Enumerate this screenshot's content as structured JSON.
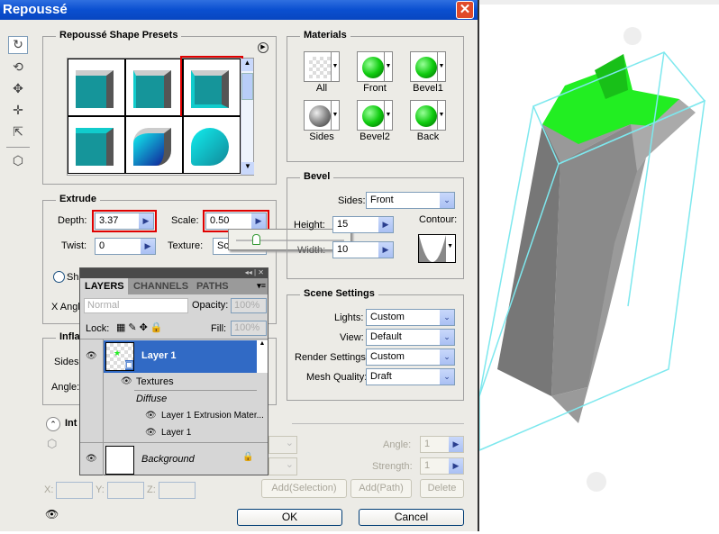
{
  "title": "Repoussé",
  "presets": {
    "title": "Repoussé Shape Presets",
    "count": 6,
    "selected_index": 2
  },
  "materials": {
    "title": "Materials",
    "items": [
      "All",
      "Front",
      "Bevel1",
      "Sides",
      "Bevel2",
      "Back"
    ]
  },
  "extrude": {
    "title": "Extrude",
    "depth_label": "Depth:",
    "depth": "3.37",
    "scale_label": "Scale:",
    "scale": "0.50",
    "twist_label": "Twist:",
    "twist": "0",
    "texture_label": "Texture:",
    "texture": "Scale",
    "shear_label": "She",
    "xangle_label": "X Angl"
  },
  "bevel": {
    "title": "Bevel",
    "sides_label": "Sides:",
    "sides": "Front",
    "height_label": "Height:",
    "height": "15",
    "width_label": "Width:",
    "width": "10",
    "contour_label": "Contour:"
  },
  "scene": {
    "title": "Scene Settings",
    "lights_label": "Lights:",
    "lights": "Custom",
    "view_label": "View:",
    "view": "Default",
    "render_label": "Render Settings:",
    "render": "Custom",
    "mesh_label": "Mesh Quality:",
    "mesh": "Draft"
  },
  "inflate": {
    "title": "Infla",
    "sides_label": "Sides:",
    "angle_label": "Angle:"
  },
  "internal": {
    "title": "Int"
  },
  "lights_panel": {
    "angle_label": "Angle:",
    "angle": "1",
    "strength_label": "Strength:",
    "strength": "1",
    "add_selection": "Add(Selection)",
    "add_path": "Add(Path)",
    "delete": "Delete",
    "x_label": "X:",
    "y_label": "Y:",
    "z_label": "Z:"
  },
  "buttons": {
    "ok": "OK",
    "cancel": "Cancel"
  },
  "layers": {
    "tabs": [
      "LAYERS",
      "CHANNELS",
      "PATHS"
    ],
    "blend": "Normal",
    "opacity_label": "Opacity:",
    "opacity": "100%",
    "lock_label": "Lock:",
    "fill_label": "Fill:",
    "fill": "100%",
    "items": [
      {
        "name": "Layer 1"
      },
      {
        "name": "Textures"
      },
      {
        "name": "Diffuse"
      },
      {
        "name": "Layer 1 Extrusion Mater..."
      },
      {
        "name": "Layer 1"
      },
      {
        "name": "Background"
      }
    ]
  },
  "colors": {
    "selection": "#316ac5",
    "highlight": "#e00000",
    "star": "#22ee22",
    "bbox": "#7ee8ee"
  }
}
